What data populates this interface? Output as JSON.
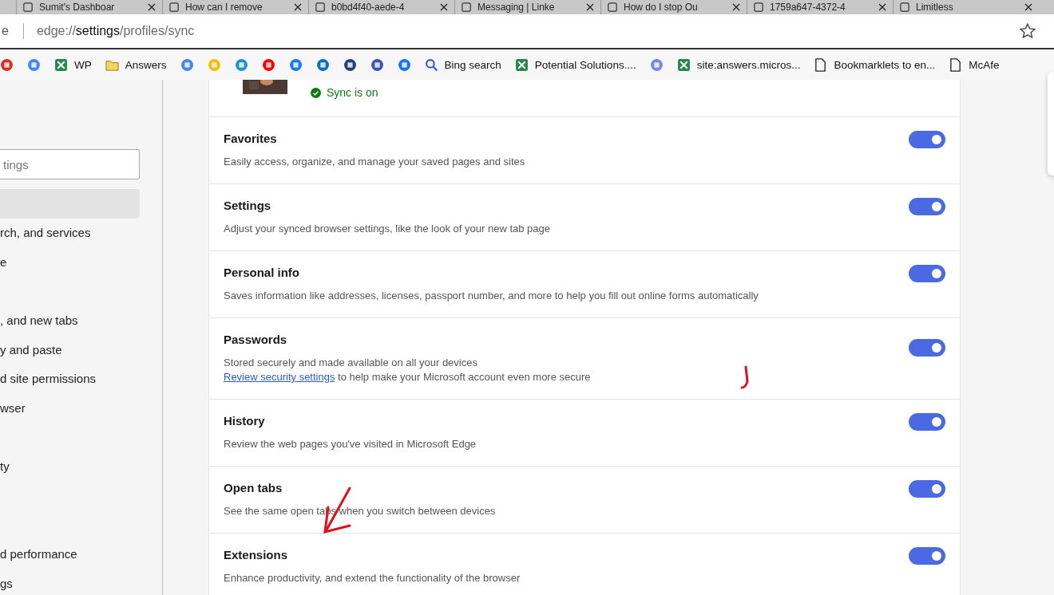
{
  "tabs": [
    {
      "title": "Sumit's Dashboar",
      "selected": false
    },
    {
      "title": "How can I remove",
      "selected": false
    },
    {
      "title": "b0bd4f40-aede-4",
      "selected": false
    },
    {
      "title": "Messaging | Linke",
      "selected": false
    },
    {
      "title": "How do I stop Ou",
      "selected": false
    },
    {
      "title": "1759a647-4372-4",
      "selected": false
    },
    {
      "title": "Limitless",
      "selected": false
    }
  ],
  "address_bar": {
    "site_info": "e",
    "scheme": "edge://",
    "host": "settings",
    "path": "/profiles/sync"
  },
  "bookmarks": [
    {
      "kind": "icon"
    },
    {
      "kind": "icon"
    },
    {
      "kind": "link",
      "label": "WP"
    },
    {
      "kind": "folder",
      "label": "Answers"
    },
    {
      "kind": "icon"
    },
    {
      "kind": "icon"
    },
    {
      "kind": "icon"
    },
    {
      "kind": "icon"
    },
    {
      "kind": "icon"
    },
    {
      "kind": "icon"
    },
    {
      "kind": "icon"
    },
    {
      "kind": "icon"
    },
    {
      "kind": "icon"
    },
    {
      "kind": "search",
      "label": "Bing search"
    },
    {
      "kind": "link",
      "label": "Potential Solutions...."
    },
    {
      "kind": "icon"
    },
    {
      "kind": "link",
      "label": "site:answers.micros..."
    },
    {
      "kind": "page",
      "label": "Bookmarklets to en..."
    },
    {
      "kind": "page",
      "label": "McAfe"
    }
  ],
  "sidebar": {
    "search": {
      "placeholder": "tings"
    },
    "items": [
      {
        "selected": true
      },
      {
        "label": "rch, and services",
        "selected": false
      },
      {
        "label": "e",
        "selected": false
      },
      {
        "label": ", and new tabs",
        "selected": false
      },
      {
        "label": "y and paste",
        "selected": false
      },
      {
        "label": "d site permissions",
        "selected": false
      },
      {
        "label": "wser",
        "selected": false
      },
      {
        "label": "ty",
        "selected": false
      },
      {
        "label": "d performance",
        "selected": false
      },
      {
        "label": "gs",
        "selected": false
      }
    ]
  },
  "profile": {
    "sync_status": "Sync is on"
  },
  "sync_items": [
    {
      "title": "Favorites",
      "description": "Easily access, organize, and manage your saved pages and sites",
      "on": true
    },
    {
      "title": "Settings",
      "description": "Adjust your synced browser settings, like the look of your new tab page",
      "on": true
    },
    {
      "title": "Personal info",
      "description": "Saves information like addresses, licenses, passport number, and more to help you fill out online forms automatically",
      "on": true
    },
    {
      "title": "Passwords",
      "description": "Stored securely and made available on all your devices",
      "link": "Review security settings",
      "link_suffix": "to help make your Microsoft account even more secure",
      "on": true
    },
    {
      "title": "History",
      "description": "Review the web pages you've visited in Microsoft Edge",
      "on": true
    },
    {
      "title": "Open tabs",
      "description": "See the same open tabs when you switch between devices",
      "on": true
    },
    {
      "title": "Extensions",
      "description": "Enhance productivity, and extend the functionality of the browser",
      "on": true
    }
  ]
}
